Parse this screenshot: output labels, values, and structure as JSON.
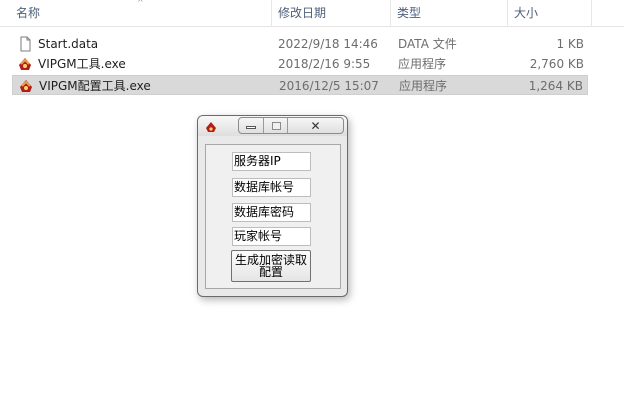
{
  "explorer": {
    "columns": [
      "名称",
      "修改日期",
      "类型",
      "大小"
    ],
    "files": [
      {
        "name": "Start.data",
        "date": "2022/9/18 14:46",
        "type": "DATA 文件",
        "size": "1 KB",
        "icon": "document-icon"
      },
      {
        "name": "VIPGM工具.exe",
        "date": "2018/2/16 9:55",
        "type": "应用程序",
        "size": "2,760 KB",
        "icon": "application-icon"
      },
      {
        "name": "VIPGM配置工具.exe",
        "date": "2016/12/5 15:07",
        "type": "应用程序",
        "size": "1,264 KB",
        "icon": "application-icon"
      }
    ],
    "sort_icon": "sort-ascending-icon"
  },
  "dialog": {
    "icon": "app-icon",
    "fields": [
      "服务器IP",
      "数据库帐号",
      "数据库密码",
      "玩家帐号"
    ],
    "button_label": "生成加密读取\n配置",
    "controls": [
      "minimize-icon",
      "maximize-icon",
      "close-icon"
    ]
  },
  "colors": {
    "header_text": "#4c607a",
    "selected_row": "#d9d9d9",
    "dialog_bg": "#e9e9e9"
  }
}
